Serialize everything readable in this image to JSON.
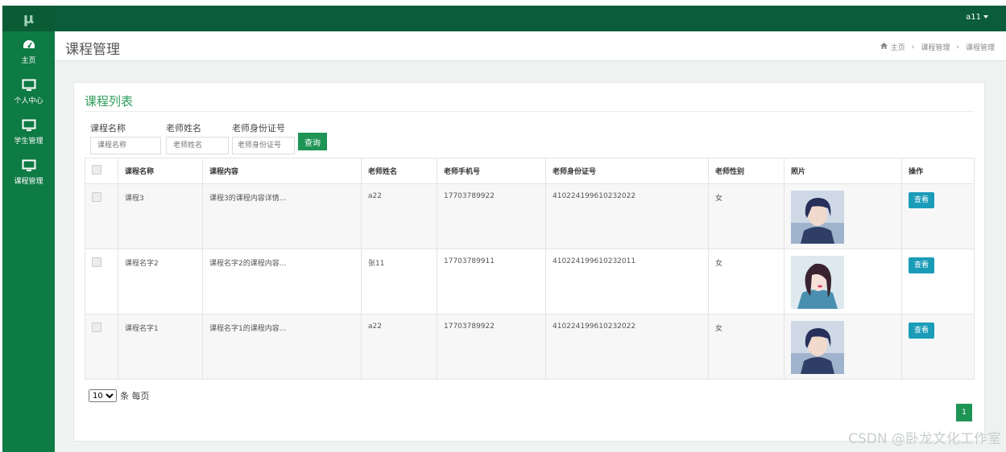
{
  "app": {
    "logo": "μ",
    "user_name": "a11"
  },
  "sidebar": {
    "items": [
      {
        "label": "主页",
        "icon": "dashboard-icon"
      },
      {
        "label": "个人中心",
        "icon": "monitor-icon"
      },
      {
        "label": "学生管理",
        "icon": "monitor-icon"
      },
      {
        "label": "课程管理",
        "icon": "monitor-icon"
      }
    ]
  },
  "header": {
    "title": "课程管理",
    "breadcrumb": [
      "主页",
      "课程管理",
      "课程管理"
    ]
  },
  "card": {
    "title": "课程列表"
  },
  "filters": {
    "course_name": {
      "label": "课程名称",
      "placeholder": "课程名称"
    },
    "teacher_name": {
      "label": "老师姓名",
      "placeholder": "老师姓名"
    },
    "teacher_id": {
      "label": "老师身份证号",
      "placeholder": "老师身份证号"
    },
    "search_label": "查询"
  },
  "table": {
    "headers": [
      "课程名称",
      "课程内容",
      "老师姓名",
      "老师手机号",
      "老师身份证号",
      "老师性别",
      "照片",
      "操作"
    ],
    "rows": [
      {
        "course": "课程3",
        "content": "课程3的课程内容详情...",
        "teacher": "a22",
        "phone": "17703789922",
        "id_no": "410224199610232022",
        "gender": "女",
        "action": "查看"
      },
      {
        "course": "课程名字2",
        "content": "课程名字2的课程内容...",
        "teacher": "张11",
        "phone": "17703789911",
        "id_no": "410224199610232011",
        "gender": "女",
        "action": "查看"
      },
      {
        "course": "课程名字1",
        "content": "课程名字1的课程内容...",
        "teacher": "a22",
        "phone": "17703789922",
        "id_no": "410224199610232022",
        "gender": "女",
        "action": "查看"
      }
    ]
  },
  "pagination": {
    "page_size": "10",
    "page_size_suffix": "条 每页",
    "current_page": "1"
  },
  "watermark": "CSDN @卧龙文化工作室"
}
